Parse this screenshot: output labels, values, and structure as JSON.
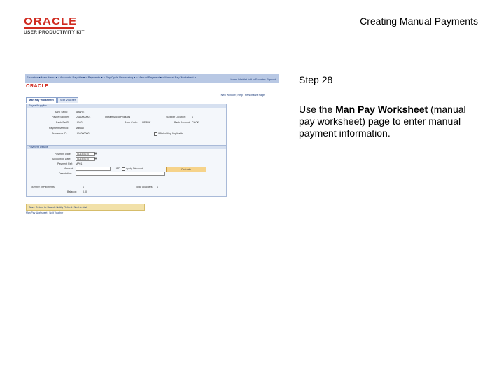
{
  "header": {
    "logo_word": "ORACLE",
    "logo_sub": "USER PRODUCTIVITY KIT",
    "doc_title": "Creating Manual Payments"
  },
  "step": {
    "label": "Step 28",
    "desc_pre": "Use the ",
    "desc_bold": "Man Pay Worksheet",
    "desc_post": " (manual pay worksheet) page to enter manual payment information."
  },
  "shot": {
    "crumbs": "Favorites ▾   Main Menu ▾   > Accounts Payable ▾ > Payments ▾ > Pay Cycle Processing ▾ > Manual Payment ▾ > Manual Pay Worksheet ▾",
    "nav_links": "Home   Worklist   Add to Favorites   Sign out",
    "brand": "ORACLE",
    "page_links": "New Window | Help | Personalize Page",
    "tabs": [
      {
        "label": "Man Pay Worksheet",
        "active": true
      },
      {
        "label": "Split Voucher",
        "active": false
      }
    ],
    "payee_section": "Payee/Supplier",
    "fields": {
      "bank_setid_lbl": "Bank SetID:",
      "bank_setid_val": "SHARE",
      "payee_supplier_lbl": "Payee/Supplier:",
      "payee_supplier_val": "USA0000001",
      "supplier_name_val": "Ingram Micro Products",
      "supplier_location_lbl": "Supplier Location:",
      "supplier_location_val": "1",
      "bank_code_lbl": "Bank SetID:",
      "bank_code_val": "USA01",
      "bank_acct_code_lbl": "Bank Code:",
      "bank_acct_code_val": "USBNK",
      "bank_account_lbl": "Bank Account:",
      "bank_account_val": "CHCK",
      "payment_method_lbl": "Payment Method:",
      "payment_method_val": "Manual",
      "processor_lbl": "Processor ID:",
      "processor_val": "USA0000001",
      "withholding_lbl": "Withholding Applicable"
    },
    "payment_section": "Payment Details",
    "payment": {
      "payment_date_lbl": "Payment Date:",
      "payment_date_val": "01/15/2010",
      "accounting_date_lbl": "Accounting Date:",
      "accounting_date_val": "01/15/2010",
      "payment_ref_lbl": "Payment Ref:",
      "payment_ref_val": "MP01",
      "amount_lbl": "Amount:",
      "amount_val": "",
      "currency_val": "USD",
      "apply_lbl": "Apply Discount",
      "description_lbl": "Description:",
      "refresh_label": "Refresh",
      "num_payments_lbl": "Number of Payments:",
      "num_payments_val": "1",
      "total_vouchers_lbl": "Total Vouchers:",
      "total_vouchers_val": "1",
      "balance_lbl": "Balance:",
      "balance_val": "0.00"
    },
    "bottom_bar": "Save   Return to Search   Notify   Refresh   Next in List",
    "bottom_links": "Man Pay Worksheet | Split Voucher"
  }
}
